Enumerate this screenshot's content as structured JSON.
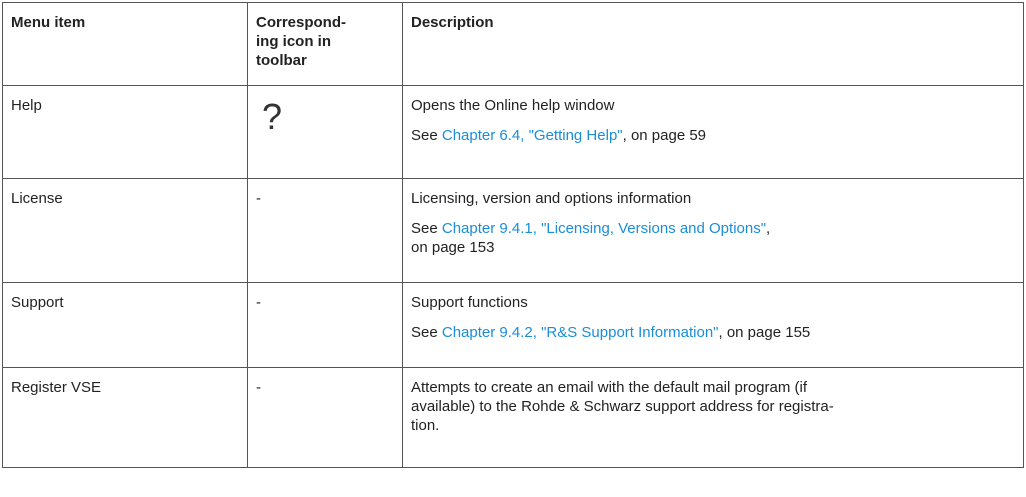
{
  "table": {
    "headers": {
      "menu_item": "Menu item",
      "icon_line1": "Correspond-",
      "icon_line2": "ing icon in",
      "icon_line3": "toolbar",
      "description": "Description"
    },
    "rows": [
      {
        "menu_item": "Help",
        "icon": "question-mark-icon",
        "icon_glyph": "?",
        "desc": "Opens the Online help window",
        "see_prefix": "See ",
        "see_link": "Chapter 6.4, \"Getting Help\"",
        "see_suffix": ", on page 59"
      },
      {
        "menu_item": "License",
        "icon_text": "-",
        "desc": "Licensing, version and options information",
        "see_prefix": "See ",
        "see_link": "Chapter 9.4.1, \"Licensing, Versions and Options\"",
        "see_suffix_line1": ",",
        "see_suffix_line2": "on page 153"
      },
      {
        "menu_item": "Support",
        "icon_text": "-",
        "desc": "Support functions",
        "see_prefix": "See ",
        "see_link": "Chapter 9.4.2, \"R&S Support Information\"",
        "see_suffix": ", on page 155"
      },
      {
        "menu_item": "Register VSE",
        "icon_text": "-",
        "desc_line1": "Attempts to create an email with the default mail program (if",
        "desc_line2": "available) to the Rohde & Schwarz support address for registra-",
        "desc_line3": "tion."
      }
    ]
  },
  "colors": {
    "link": "#1a8ed8",
    "border": "#555555",
    "text": "#222222"
  }
}
